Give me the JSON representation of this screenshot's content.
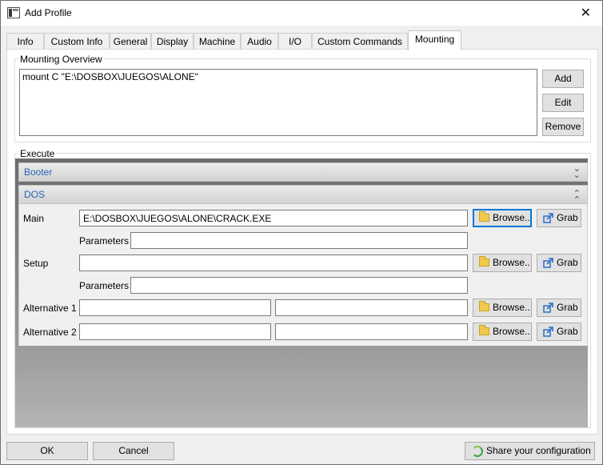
{
  "window": {
    "title": "Add Profile"
  },
  "tabs": [
    {
      "label": "Info"
    },
    {
      "label": "Custom Info"
    },
    {
      "label": "General"
    },
    {
      "label": "Display"
    },
    {
      "label": "Machine"
    },
    {
      "label": "Audio"
    },
    {
      "label": "I/O"
    },
    {
      "label": "Custom Commands"
    },
    {
      "label": "Mounting"
    }
  ],
  "mounting": {
    "group_label": "Mounting Overview",
    "entries": [
      "mount C \"E:\\DOSBOX\\JUEGOS\\ALONE\""
    ],
    "add_label": "Add",
    "edit_label": "Edit",
    "remove_label": "Remove"
  },
  "execute": {
    "group_label": "Execute",
    "booter_label": "Booter",
    "dos_label": "DOS",
    "main_label": "Main",
    "main_value": "E:\\DOSBOX\\JUEGOS\\ALONE\\CRACK.EXE",
    "main_params_label": "Parameters",
    "main_params_value": "",
    "setup_label": "Setup",
    "setup_value": "",
    "setup_params_label": "Parameters",
    "setup_params_value": "",
    "alt1_label": "Alternative 1",
    "alt1_value": "",
    "alt1_params_value": "",
    "alt2_label": "Alternative 2",
    "alt2_value": "",
    "alt2_params_value": "",
    "browse_label": "Browse..",
    "grab_label": "Grab"
  },
  "footer": {
    "ok_label": "OK",
    "cancel_label": "Cancel",
    "share_label": "Share your configuration"
  },
  "icons": {
    "title": "app-window-icon",
    "close": "close-icon",
    "browse": "folder-icon",
    "grab": "grab-arrow-icon",
    "share": "refresh-share-icon",
    "collapse": "chevron-double-up-icon",
    "expand": "chevron-double-down-icon"
  },
  "colors": {
    "accent": "#0078d7",
    "section_title": "#2563b8",
    "folder": "#f2c94c"
  }
}
